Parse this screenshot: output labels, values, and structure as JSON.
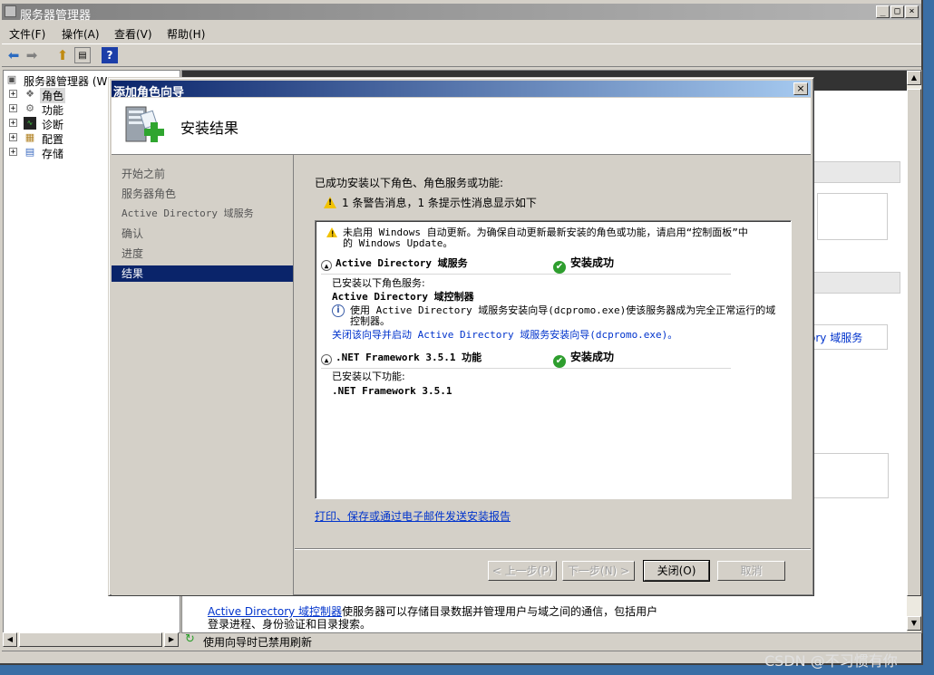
{
  "window": {
    "title": "服务器管理器",
    "min_label": "_",
    "max_label": "□",
    "close_label": "×"
  },
  "menubar": {
    "items": [
      "文件(F)",
      "操作(A)",
      "查看(V)",
      "帮助(H)"
    ]
  },
  "toolbar": {
    "help_label": "?"
  },
  "tree": {
    "root": "服务器管理器 (WIN-...",
    "items": [
      "角色",
      "功能",
      "诊断",
      "配置",
      "存储"
    ]
  },
  "right_pane": {
    "side_link": "ory 域服务",
    "bottom_link": "Active Directory 域控制器",
    "bottom_text_1": "使服务器可以存储目录数据并管理用户与域之间的通信，包括用户",
    "bottom_text_2": "登录进程、身份验证和目录搜索。"
  },
  "statusbar": {
    "text": "使用向导时已禁用刷新"
  },
  "watermark": "CSDN @不习惯有你",
  "dialog": {
    "title": "添加角色向导",
    "close_label": "×",
    "header_title": "安装结果",
    "nav": [
      "开始之前",
      "服务器角色",
      "Active Directory 域服务",
      "确认",
      "进度",
      "结果"
    ],
    "selected_nav": "结果",
    "intro": "已成功安装以下角色、角色服务或功能:",
    "warning_summary": "1 条警告消息，1 条提示性消息显示如下",
    "results": {
      "warning_line1": "未启用 Windows 自动更新。为确保自动更新最新安装的角色或功能，请启用“控制面板”中",
      "warning_line2": "的 Windows Update。",
      "ad_section_title": "Active Directory 域服务",
      "ad_status": "安装成功",
      "ad_installed_label": "已安装以下角色服务:",
      "ad_service": "Active Directory 域控制器",
      "ad_info_line1": "使用 Active Directory 域服务安装向导(dcpromo.exe)使该服务器成为完全正常运行的域",
      "ad_info_line2": "控制器。",
      "ad_link": "关闭该向导并启动 Active Directory 域服务安装向导(dcpromo.exe)。",
      "net_section_title": ".NET Framework 3.5.1 功能",
      "net_status": "安装成功",
      "net_installed_label": "已安装以下功能:",
      "net_feature": ".NET Framework 3.5.1"
    },
    "report_link": "打印、保存或通过电子邮件发送安装报告",
    "buttons": {
      "prev": "< 上一步(P)",
      "next": "下一步(N) >",
      "close": "关闭(O)",
      "cancel": "取消"
    }
  }
}
